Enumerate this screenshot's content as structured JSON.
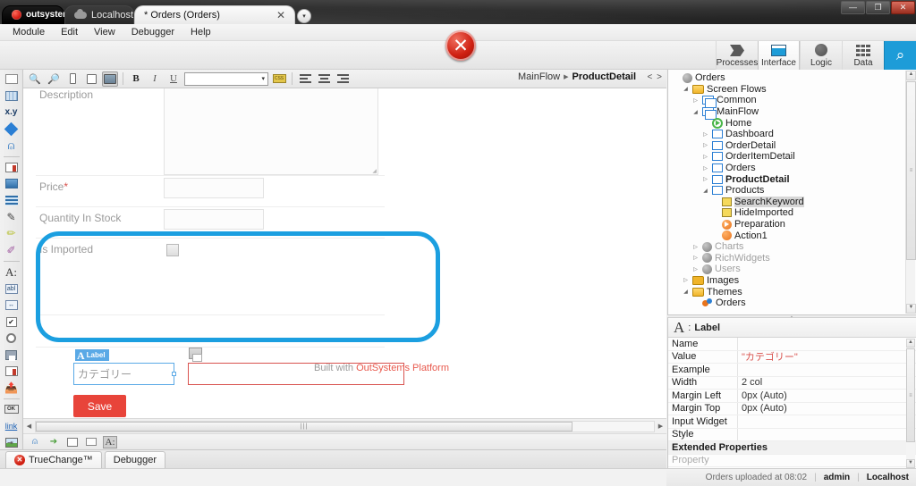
{
  "titlebar": {
    "os_tab": "outsystems",
    "env_tab": "Localhost",
    "doc_tab": "* Orders (Orders)",
    "close_glyph": "✕",
    "dropdown_glyph": "▾",
    "window_controls": {
      "minimize": "—",
      "maximize": "❐",
      "close": "✕"
    }
  },
  "menubar": {
    "items": [
      "Module",
      "Edit",
      "View",
      "Debugger",
      "Help"
    ]
  },
  "ribbon": {
    "error_badge": "✕",
    "buttons": [
      {
        "label": "Processes",
        "icon": "processes-icon"
      },
      {
        "label": "Interface",
        "icon": "interface-icon"
      },
      {
        "label": "Logic",
        "icon": "logic-icon"
      },
      {
        "label": "Data",
        "icon": "data-icon"
      }
    ],
    "search_glyph": "⌕"
  },
  "toolbox": {
    "items": [
      "container-icon",
      "table-icon",
      "expression-icon",
      "if-icon",
      "widget-icon",
      "list-records-icon",
      "table-records-icon",
      "list-icon",
      "edit-record-icon",
      "highlight-icon",
      "paint-icon",
      "label-icon",
      "input-icon",
      "input-group-icon",
      "checkbox-icon",
      "radio-button-icon",
      "save-icon",
      "list-box-icon",
      "upload-icon",
      "button-icon",
      "link-icon",
      "image-icon"
    ],
    "expand_glyph": "⇥"
  },
  "editor_toolbar": {
    "tools": [
      "zoom-out-icon",
      "zoom-in-icon",
      "phone-preview-icon",
      "tablet-preview-icon",
      "desktop-preview-icon"
    ],
    "bold": "B",
    "italic": "I",
    "underline": "U",
    "style_select_value": "",
    "style_caret": "▾",
    "css_icon": "css-icon",
    "align": [
      "align-left-icon",
      "align-center-icon",
      "align-right-icon"
    ],
    "breadcrumb_flow": "MainFlow",
    "breadcrumb_sep": "▶",
    "breadcrumb_screen": "ProductDetail",
    "nav_glyph": "< >"
  },
  "canvas": {
    "rows": [
      {
        "label": "Description",
        "required": false,
        "control": "textarea"
      },
      {
        "label": "Price",
        "required": true,
        "control": "input"
      },
      {
        "label": "Quantity In Stock",
        "required": false,
        "control": "input"
      },
      {
        "label": "Is Imported",
        "required": false,
        "control": "checkbox"
      }
    ],
    "selected_widget_tag": "Label",
    "selected_widget_icon": "A",
    "selected_label_text": "カテゴリー",
    "save_button_label": "Save",
    "footer_prefix": "Built with ",
    "footer_brand": "OutSystems Platform",
    "highlight_color": "#1b9fe0",
    "selection_color": "#5aa9e6",
    "error_border_color": "#d9534f"
  },
  "tree": {
    "nodes": [
      {
        "label": "Orders",
        "indent": 0,
        "icon": "module-icon",
        "expander": "",
        "state": "normal"
      },
      {
        "label": "Screen Flows",
        "indent": 1,
        "icon": "folder-open-icon",
        "expander": "◢",
        "state": "normal"
      },
      {
        "label": "Common",
        "indent": 2,
        "icon": "flow-icon",
        "expander": "▷",
        "state": "normal"
      },
      {
        "label": "MainFlow",
        "indent": 2,
        "icon": "flow-icon",
        "expander": "◢",
        "state": "normal"
      },
      {
        "label": "Home",
        "indent": 3,
        "icon": "home-screen-icon",
        "expander": "",
        "state": "normal"
      },
      {
        "label": "Dashboard",
        "indent": 3,
        "icon": "screen-icon",
        "expander": "▷",
        "state": "normal"
      },
      {
        "label": "OrderDetail",
        "indent": 3,
        "icon": "screen-icon",
        "expander": "▷",
        "state": "normal"
      },
      {
        "label": "OrderItemDetail",
        "indent": 3,
        "icon": "screen-icon",
        "expander": "▷",
        "state": "normal"
      },
      {
        "label": "Orders",
        "indent": 3,
        "icon": "screen-icon",
        "expander": "▷",
        "state": "normal"
      },
      {
        "label": "ProductDetail",
        "indent": 3,
        "icon": "screen-icon",
        "expander": "▷",
        "state": "bold"
      },
      {
        "label": "Products",
        "indent": 3,
        "icon": "screen-icon",
        "expander": "◢",
        "state": "normal"
      },
      {
        "label": "SearchKeyword",
        "indent": 4,
        "icon": "variable-icon",
        "expander": "",
        "state": "selected"
      },
      {
        "label": "HideImported",
        "indent": 4,
        "icon": "variable-icon",
        "expander": "",
        "state": "normal"
      },
      {
        "label": "Preparation",
        "indent": 4,
        "icon": "preparation-icon",
        "expander": "",
        "state": "normal"
      },
      {
        "label": "Action1",
        "indent": 4,
        "icon": "action-icon",
        "expander": "",
        "state": "normal"
      },
      {
        "label": "Charts",
        "indent": 2,
        "icon": "module-icon",
        "expander": "▷",
        "state": "dim"
      },
      {
        "label": "RichWidgets",
        "indent": 2,
        "icon": "module-icon",
        "expander": "▷",
        "state": "dim"
      },
      {
        "label": "Users",
        "indent": 2,
        "icon": "module-icon",
        "expander": "▷",
        "state": "dim"
      },
      {
        "label": "Images",
        "indent": 1,
        "icon": "folder-icon",
        "expander": "▷",
        "state": "normal"
      },
      {
        "label": "Themes",
        "indent": 1,
        "icon": "folder-open-icon",
        "expander": "◢",
        "state": "normal"
      },
      {
        "label": "Orders",
        "indent": 2,
        "icon": "theme-icon",
        "expander": "",
        "state": "normal"
      }
    ],
    "scroll_up_glyph": "▲",
    "scroll_down_glyph": "▼",
    "thumb_glyph": "≡"
  },
  "properties": {
    "widget_icon": "A",
    "widget_type": "Label",
    "rows": [
      {
        "name": "Name",
        "value": "",
        "caret": true,
        "red": false
      },
      {
        "name": "Value",
        "value": "\"カテゴリー\"",
        "caret": true,
        "red": true
      },
      {
        "name": "Example",
        "value": "",
        "caret": false,
        "red": false
      },
      {
        "name": "Width",
        "value": "2 col",
        "caret": true,
        "red": false
      },
      {
        "name": "Margin Left",
        "value": "0px (Auto)",
        "caret": true,
        "red": false
      },
      {
        "name": "Margin Top",
        "value": "0px (Auto)",
        "caret": true,
        "red": false
      },
      {
        "name": "Input Widget",
        "value": "",
        "caret": true,
        "red": false
      },
      {
        "name": "Style",
        "value": "",
        "caret": true,
        "red": false
      }
    ],
    "section_label": "Extended Properties",
    "placeholder_row": {
      "name": "Property",
      "value": "",
      "caret": true
    },
    "caret_glyph": "▾",
    "scroll_up_glyph": "▲",
    "scroll_down_glyph": "▼",
    "thumb_glyph": "≡"
  },
  "bottom_tabs": {
    "truechange": {
      "label": "TrueChange™",
      "badge": "✕"
    },
    "debugger": {
      "label": "Debugger"
    }
  },
  "statusbar": {
    "message": "Orders uploaded at 08:02",
    "separator": "|",
    "user": "admin",
    "environment": "Localhost"
  },
  "hscroll": {
    "left_glyph": "◀",
    "right_glyph": "▶",
    "grip_glyph": "|||"
  },
  "bottom_strip": {
    "icons": [
      "widget-icon",
      "publish-icon",
      "record-list-icon",
      "container-icon",
      "label-icon"
    ]
  }
}
